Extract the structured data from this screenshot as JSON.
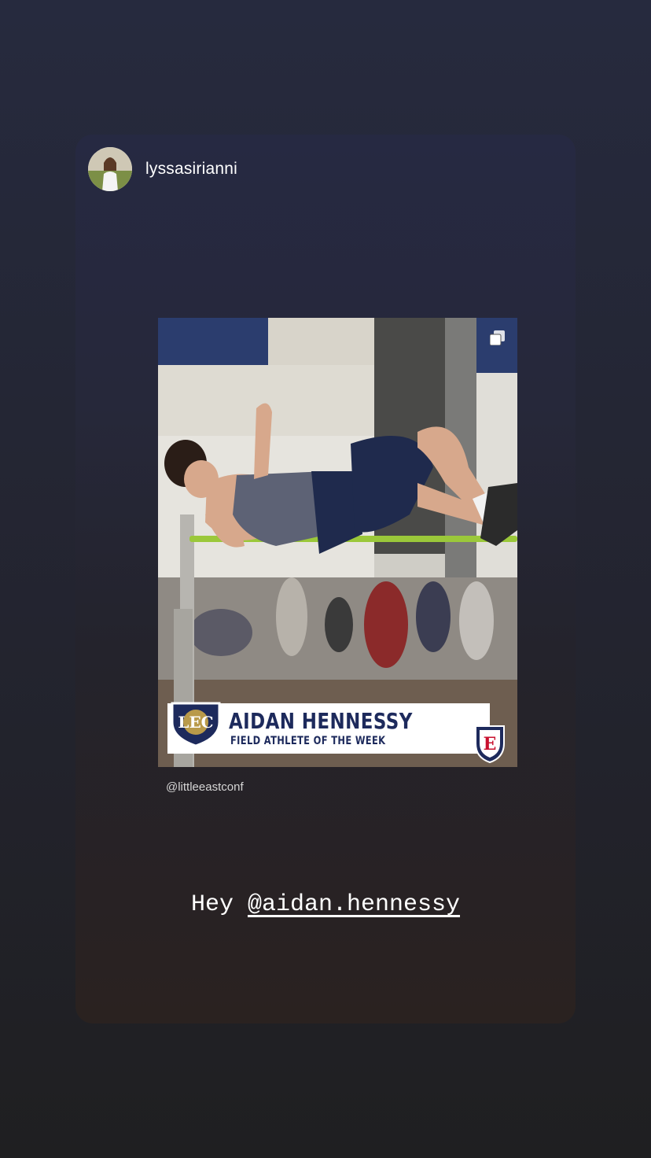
{
  "story": {
    "username": "lyssasirianni",
    "avatar_icon": "profile-photo"
  },
  "shared_post": {
    "multi_post_icon": "carousel-squares-icon",
    "banner": {
      "conference_logo_text": "LEC",
      "athlete_name": "AIDAN HENNESSY",
      "award": "FIELD ATHLETE OF THE WEEK",
      "school_logo_text": "E"
    },
    "source": "@littleeastconf"
  },
  "caption": {
    "prefix": "Hey",
    "mention": "@aidan.hennessy"
  },
  "colors": {
    "background_top": "#262a3e",
    "background_bottom": "#1f1f21",
    "banner_navy": "#1d2a5c",
    "school_red": "#c8102e"
  }
}
